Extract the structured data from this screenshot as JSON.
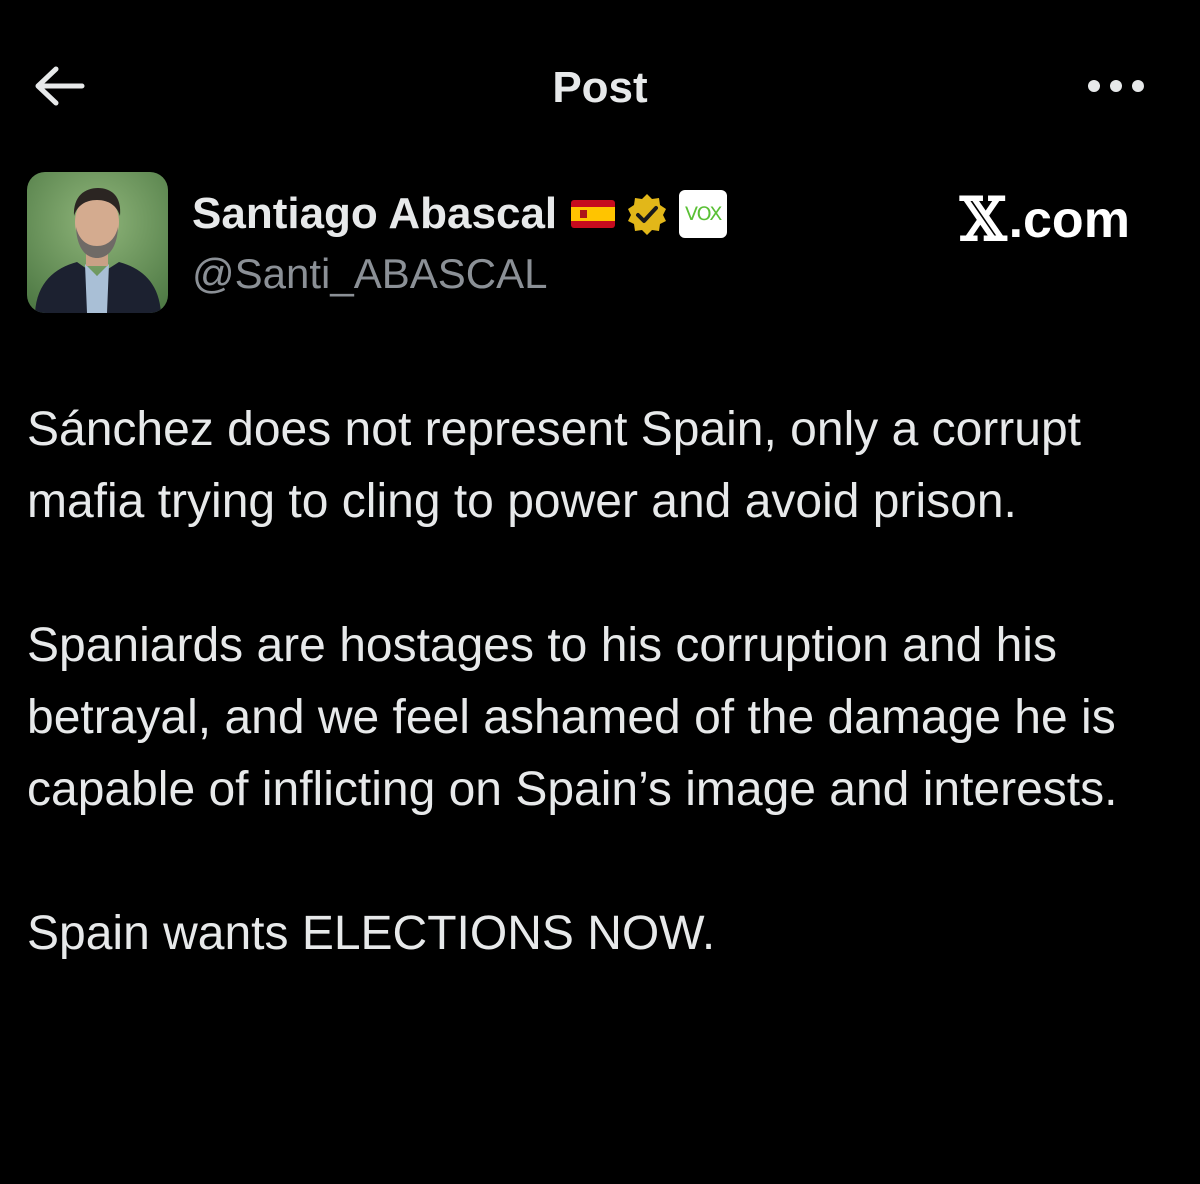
{
  "header": {
    "title": "Post",
    "back_icon": "arrow-left-icon",
    "more_icon": "more-horizontal-icon"
  },
  "author": {
    "display_name": "Santiago Abascal",
    "handle": "@Santi_ABASCAL",
    "flag_icon": "spain-flag-icon",
    "verified_icon": "gold-verified-badge-icon",
    "affiliation_badge_text": "VOX"
  },
  "brand": {
    "text": ".com",
    "logo": "x-logo"
  },
  "tweet": {
    "paragraphs": [
      "Sánchez does not represent Spain, only a corrupt mafia trying to cling to power and avoid prison.",
      "Spaniards are hostages to his corruption and his betrayal, and we feel ashamed of the damage he is capable of inflicting on Spain’s image and interests.",
      "Spain wants ELECTIONS NOW."
    ]
  },
  "colors": {
    "background": "#000000",
    "text_primary": "#e7e9ea",
    "text_secondary": "#8b9096",
    "verified_gold": "#e2b719",
    "vox_green": "#5ac035"
  }
}
